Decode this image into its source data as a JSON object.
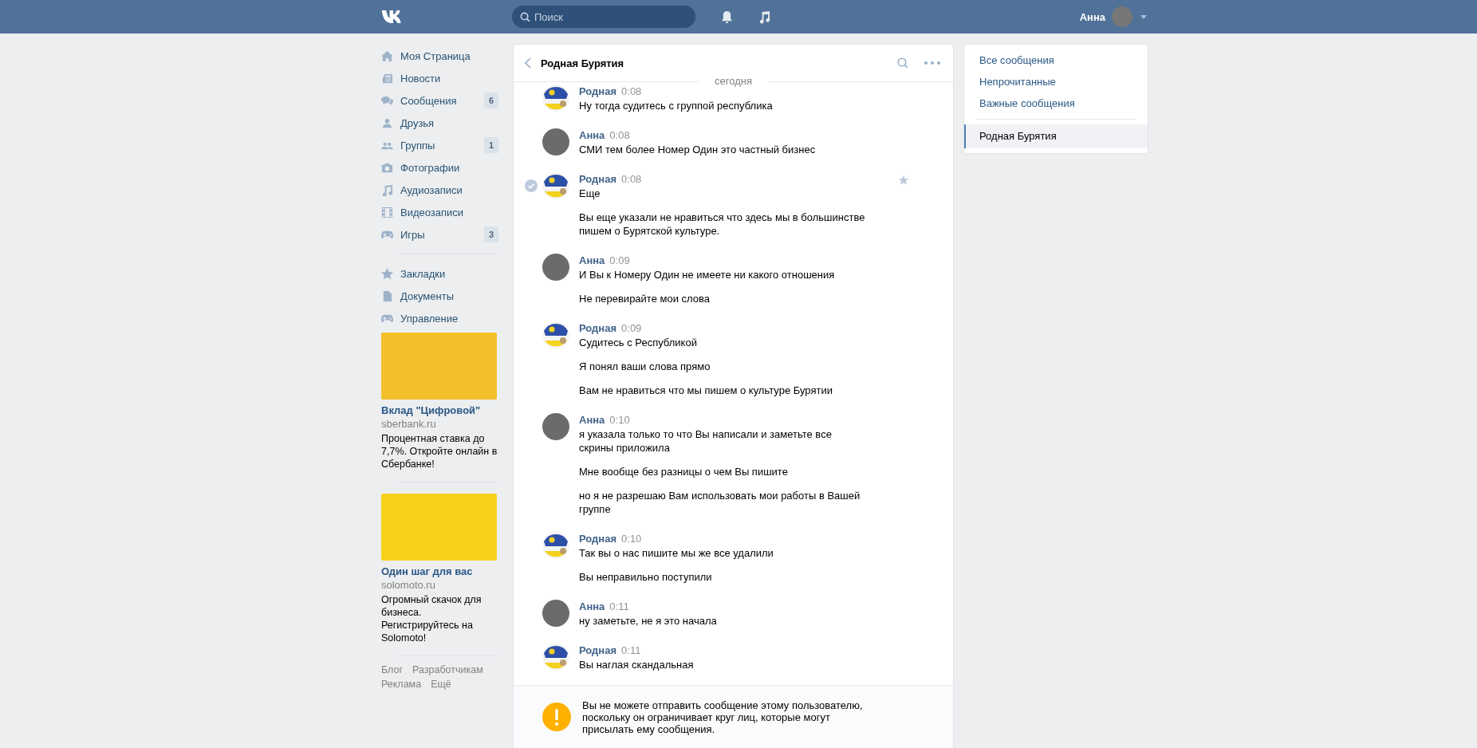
{
  "topbar": {
    "search": {
      "placeholder": "Поиск"
    },
    "user_name": "Анна"
  },
  "sidebar": {
    "items": [
      {
        "label": "Моя Страница"
      },
      {
        "label": "Новости"
      },
      {
        "label": "Сообщения",
        "counter": "6"
      },
      {
        "label": "Друзья"
      },
      {
        "label": "Группы",
        "counter": "1"
      },
      {
        "label": "Фотографии"
      },
      {
        "label": "Аудиозаписи"
      },
      {
        "label": "Видеозаписи"
      },
      {
        "label": "Игры",
        "counter": "3"
      },
      {
        "label": "Закладки"
      },
      {
        "label": "Документы"
      },
      {
        "label": "Управление"
      }
    ],
    "ads": [
      {
        "title": "Вклад \"Цифровой\"",
        "domain": "sberbank.ru",
        "text": "Процентная ставка до 7,7%. Откройте онлайн в Сбербанке!",
        "color": "#f3c02c"
      },
      {
        "title": "Один шаг для вас",
        "domain": "solomoto.ru",
        "text": "Огромный скачок для бизнеса. Регистрируйтесь на Solomoto!",
        "color": "#f7d21c"
      }
    ],
    "footer_links": [
      "Блог",
      "Разработчикам",
      "Реклама",
      "Ещё"
    ]
  },
  "chat": {
    "title": "Родная Бурятия",
    "date_separator": "сегодня",
    "messages": [
      {
        "author": "Родная",
        "kind": "group",
        "time": "0:08",
        "selected": false,
        "paragraphs": [
          "Ну тогда судитесь с группой республика"
        ]
      },
      {
        "author": "Анна",
        "kind": "user",
        "time": "0:08",
        "selected": false,
        "paragraphs": [
          "СМИ тем более Номер Один это частный бизнес"
        ]
      },
      {
        "author": "Родная",
        "kind": "group",
        "time": "0:08",
        "selected": true,
        "paragraphs": [
          "Еще",
          "Вы еще указали не нравиться что здесь мы в большинстве пишем о Бурятской культуре."
        ]
      },
      {
        "author": "Анна",
        "kind": "user",
        "time": "0:09",
        "selected": false,
        "paragraphs": [
          "И Вы к Номеру Один не имеете ни какого отношения",
          "Не перевирайте мои слова"
        ]
      },
      {
        "author": "Родная",
        "kind": "group",
        "time": "0:09",
        "selected": false,
        "paragraphs": [
          "Судитесь с Республикой",
          "Я понял ваши слова прямо",
          "Вам не нравиться что мы пишем о культуре Бурятии"
        ]
      },
      {
        "author": "Анна",
        "kind": "user",
        "time": "0:10",
        "selected": false,
        "paragraphs": [
          "я указала только то что Вы написали и заметьте все скрины приложила",
          "Мне вообще без разницы о чем Вы пишите",
          "но я не разрешаю Вам использовать мои работы в Вашей группе"
        ]
      },
      {
        "author": "Родная",
        "kind": "group",
        "time": "0:10",
        "selected": false,
        "paragraphs": [
          "Так вы о нас пишите мы же все удалили",
          "Вы неправильно поступили"
        ]
      },
      {
        "author": "Анна",
        "kind": "user",
        "time": "0:11",
        "selected": false,
        "paragraphs": [
          "ну заметьте, не я это начала"
        ]
      },
      {
        "author": "Родная",
        "kind": "group",
        "time": "0:11",
        "selected": false,
        "paragraphs": [
          "Вы наглая скандальная"
        ]
      }
    ],
    "notice": "Вы не можете отправить сообщение этому пользователю, поскольку он ограничивает круг лиц, которые могут присылать ему сообщения."
  },
  "filters": {
    "items": [
      {
        "label": "Все сообщения",
        "selected": false
      },
      {
        "label": "Непрочитанные",
        "selected": false
      },
      {
        "label": "Важные сообщения",
        "selected": false
      },
      {
        "label": "Родная Бурятия",
        "selected": true
      }
    ]
  }
}
